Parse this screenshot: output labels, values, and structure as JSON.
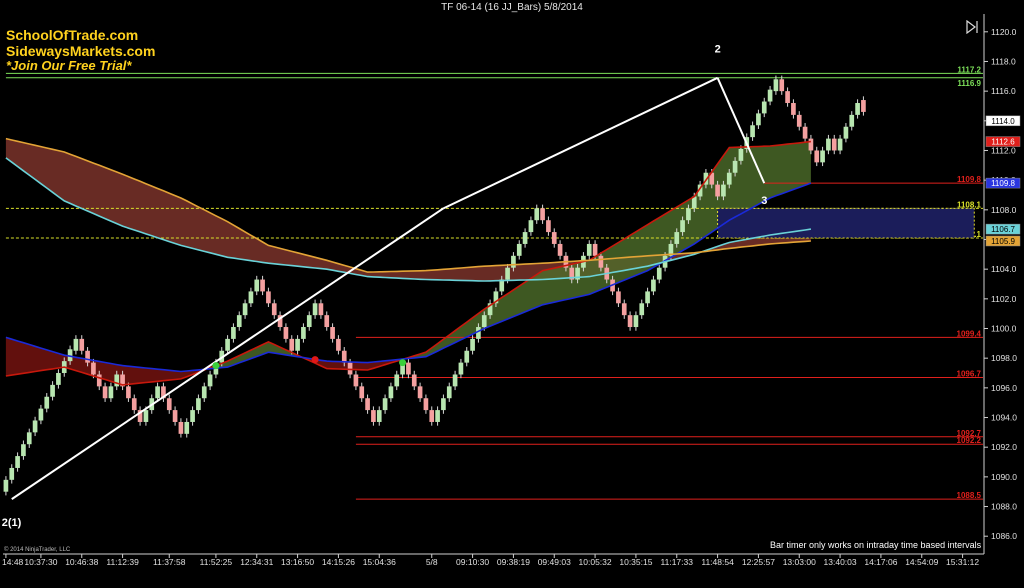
{
  "window": {
    "title": "TF 06-14 (16 JJ_Bars)  5/8/2014"
  },
  "promo": {
    "line1": "SchoolOfTrade.com",
    "line2": "SidewaysMarkets.com",
    "line3": "*Join Our Free Trial*"
  },
  "footer": {
    "copyright": "© 2014 NinjaTrader, LLC",
    "timer_note": "Bar timer only works on intraday time based intervals"
  },
  "colors": {
    "background": "#000000",
    "up_bar": "#b8e6b0",
    "down_bar": "#f4a0a0",
    "wick": "#d8d8d8",
    "red_level": "#e0201c",
    "green_level": "#7de05a",
    "yellow_level": "#d9e02a",
    "blue_ma": "#1a2ad8",
    "red_ma": "#c8180c",
    "cyan_ma": "#6ad2d8",
    "orange_ma": "#e3a436",
    "cloud_red": "#8b3a30",
    "cloud_green": "#4d6e2a",
    "zone_fill": "#1b1d5a",
    "zone_border": "#e6e030",
    "trend_line": "#ffffff"
  },
  "chart_data": {
    "type": "line",
    "title": "TF 06-14 (16 JJ_Bars)  5/8/2014",
    "ylim": [
      1084.8,
      1121.2
    ],
    "y_ticks": [
      "1086.0",
      "1088.0",
      "1090.0",
      "1092.0",
      "1094.0",
      "1096.0",
      "1098.0",
      "1100.0",
      "1102.0",
      "1104.0",
      "1106.0",
      "1108.0",
      "1110.0",
      "1112.0",
      "1114.0",
      "1116.0",
      "1118.0",
      "1120.0"
    ],
    "x_tick_labels": [
      "14:48",
      "10:37:30",
      "10:46:38",
      "11:12:39",
      "11:37:58",
      "11:52:25",
      "12:34:31",
      "13:16:50",
      "14:15:26",
      "15:04:36",
      "5/8",
      "09:10:30",
      "09:38:19",
      "09:49:03",
      "10:05:32",
      "10:35:15",
      "11:17:33",
      "11:48:54",
      "12:25:57",
      "13:03:00",
      "13:40:03",
      "14:17:06",
      "14:54:09",
      "15:31:12"
    ],
    "x_tick_index": [
      0,
      6,
      13,
      20,
      28,
      36,
      43,
      50,
      57,
      64,
      73,
      80,
      87,
      94,
      101,
      108,
      115,
      122,
      129,
      136,
      143,
      150,
      157,
      164
    ],
    "bar_count": 121,
    "slot_count": 168,
    "closes": [
      1089.8,
      1090.6,
      1091.4,
      1092.2,
      1093.0,
      1093.8,
      1094.6,
      1095.4,
      1096.2,
      1097.0,
      1097.8,
      1098.6,
      1099.3,
      1098.5,
      1097.7,
      1096.9,
      1096.1,
      1095.3,
      1096.1,
      1096.9,
      1096.1,
      1095.3,
      1094.5,
      1093.7,
      1094.5,
      1095.3,
      1096.1,
      1095.3,
      1094.5,
      1093.7,
      1092.9,
      1093.7,
      1094.5,
      1095.3,
      1096.1,
      1096.9,
      1097.7,
      1098.5,
      1099.3,
      1100.1,
      1100.9,
      1101.7,
      1102.5,
      1103.3,
      1102.5,
      1101.7,
      1100.9,
      1100.1,
      1099.3,
      1098.5,
      1099.3,
      1100.1,
      1100.9,
      1101.7,
      1100.9,
      1100.1,
      1099.3,
      1098.5,
      1097.7,
      1096.9,
      1096.1,
      1095.3,
      1094.5,
      1093.7,
      1094.5,
      1095.3,
      1096.1,
      1096.9,
      1097.7,
      1096.9,
      1096.1,
      1095.3,
      1094.5,
      1093.7,
      1094.5,
      1095.3,
      1096.1,
      1096.9,
      1097.7,
      1098.5,
      1099.3,
      1100.1,
      1100.9,
      1101.7,
      1102.5,
      1103.3,
      1104.1,
      1104.9,
      1105.7,
      1106.5,
      1107.3,
      1108.1,
      1107.3,
      1106.5,
      1105.7,
      1104.9,
      1104.1,
      1103.3,
      1104.1,
      1104.9,
      1105.7,
      1104.9,
      1104.1,
      1103.3,
      1102.5,
      1101.7,
      1100.9,
      1100.1,
      1100.9,
      1101.7,
      1102.5,
      1103.3,
      1104.1,
      1104.9,
      1105.7,
      1106.5,
      1107.3,
      1108.1,
      1108.9,
      1109.7,
      1110.5
    ],
    "closes_tail": [
      1109.7,
      1108.9,
      1109.7,
      1110.5,
      1111.3,
      1112.1,
      1112.9,
      1113.7,
      1114.5,
      1115.3,
      1116.1,
      1116.8,
      1116.0,
      1115.2,
      1114.4,
      1113.6,
      1112.8,
      1112.0,
      1111.2,
      1112.0,
      1112.8,
      1112.0,
      1112.8,
      1113.6,
      1114.4,
      1115.2,
      1114.6
    ],
    "series": [
      {
        "name": "",
        "role": "fast-red-ma",
        "points": [
          [
            0,
            1096.8
          ],
          [
            10,
            1097.4
          ],
          [
            20,
            1096.2
          ],
          [
            30,
            1096.6
          ],
          [
            38,
            1097.8
          ],
          [
            45,
            1099.1
          ],
          [
            55,
            1097.3
          ],
          [
            62,
            1097.2
          ],
          [
            72,
            1098.4
          ],
          [
            82,
            1101.3
          ],
          [
            92,
            1103.9
          ],
          [
            100,
            1104.6
          ],
          [
            110,
            1107.0
          ],
          [
            118,
            1108.9
          ],
          [
            124,
            1112.2
          ],
          [
            131,
            1112.3
          ],
          [
            138,
            1112.6
          ]
        ]
      },
      {
        "name": "",
        "role": "blue-ma",
        "points": [
          [
            0,
            1099.4
          ],
          [
            10,
            1098.2
          ],
          [
            20,
            1097.5
          ],
          [
            30,
            1097.1
          ],
          [
            38,
            1097.4
          ],
          [
            45,
            1098.4
          ],
          [
            55,
            1097.8
          ],
          [
            62,
            1097.7
          ],
          [
            72,
            1098.1
          ],
          [
            82,
            1100.0
          ],
          [
            92,
            1101.6
          ],
          [
            100,
            1102.3
          ],
          [
            110,
            1103.9
          ],
          [
            118,
            1105.7
          ],
          [
            124,
            1107.3
          ],
          [
            131,
            1108.8
          ],
          [
            138,
            1109.8
          ]
        ]
      },
      {
        "name": "",
        "role": "cyan-ma",
        "points": [
          [
            0,
            1111.5
          ],
          [
            10,
            1108.6
          ],
          [
            20,
            1106.9
          ],
          [
            30,
            1105.6
          ],
          [
            38,
            1104.8
          ],
          [
            45,
            1104.4
          ],
          [
            55,
            1104.0
          ],
          [
            62,
            1103.5
          ],
          [
            72,
            1103.3
          ],
          [
            82,
            1103.2
          ],
          [
            92,
            1103.3
          ],
          [
            100,
            1103.5
          ],
          [
            110,
            1104.2
          ],
          [
            118,
            1105.0
          ],
          [
            124,
            1105.8
          ],
          [
            131,
            1106.3
          ],
          [
            138,
            1106.7
          ]
        ]
      },
      {
        "name": "",
        "role": "orange-ma",
        "points": [
          [
            0,
            1112.8
          ],
          [
            10,
            1111.9
          ],
          [
            20,
            1110.4
          ],
          [
            30,
            1108.8
          ],
          [
            38,
            1107.2
          ],
          [
            45,
            1105.6
          ],
          [
            55,
            1104.6
          ],
          [
            62,
            1103.8
          ],
          [
            72,
            1103.9
          ],
          [
            82,
            1104.2
          ],
          [
            92,
            1104.4
          ],
          [
            100,
            1104.6
          ],
          [
            110,
            1104.9
          ],
          [
            118,
            1105.1
          ],
          [
            124,
            1105.4
          ],
          [
            131,
            1105.7
          ],
          [
            138,
            1105.9
          ]
        ]
      }
    ],
    "horizontal_levels": [
      {
        "value": "1117.2",
        "y": 1117.2,
        "color": "green",
        "label_color": "#7de05a"
      },
      {
        "value": "1116.9",
        "y": 1116.9,
        "color": "green",
        "label_color": "#7de05a"
      },
      {
        "value": "1109.8",
        "y": 1109.8,
        "color": "red",
        "label_color": "#e0201c"
      },
      {
        "value": "1108.1",
        "y": 1108.1,
        "color": "yellow",
        "label_color": "#d9e02a"
      },
      {
        "value": "1106.1",
        "y": 1106.1,
        "color": "yellow",
        "label_color": "#d9e02a"
      },
      {
        "value": "1099.4",
        "y": 1099.4,
        "color": "red",
        "label_color": "#e0201c"
      },
      {
        "value": "1096.7",
        "y": 1096.7,
        "color": "red",
        "label_color": "#e0201c"
      },
      {
        "value": "1092.7",
        "y": 1092.7,
        "color": "red",
        "label_color": "#e0201c"
      },
      {
        "value": "1092.2",
        "y": 1092.2,
        "color": "red",
        "label_color": "#e0201c"
      },
      {
        "value": "1088.5",
        "y": 1088.5,
        "color": "red",
        "label_color": "#e0201c"
      }
    ],
    "axis_badges": [
      {
        "value": "1114.0",
        "y": 1114.0,
        "bg": "#ffffff",
        "fg": "#000000"
      },
      {
        "value": "1112.6",
        "y": 1112.6,
        "bg": "#e0201c",
        "fg": "#ffffff"
      },
      {
        "value": "1109.8",
        "y": 1109.8,
        "bg": "#2a36e0",
        "fg": "#ffffff"
      },
      {
        "value": "1106.7",
        "y": 1106.7,
        "bg": "#6ad2d8",
        "fg": "#000000"
      },
      {
        "value": "1105.9",
        "y": 1105.9,
        "bg": "#e3a436",
        "fg": "#000000"
      }
    ],
    "trend_line_points": [
      [
        1,
        1088.5
      ],
      [
        75,
        1108.1
      ],
      [
        122,
        1116.9
      ],
      [
        130,
        1109.8
      ]
    ],
    "swing_labels": [
      {
        "text": "2(1)",
        "x": 1,
        "y": 1086.7
      },
      {
        "text": "2",
        "x": 122,
        "y": 1118.6
      },
      {
        "text": "3",
        "x": 130,
        "y": 1108.4
      }
    ],
    "zone": {
      "x_start": 122,
      "x_end": 166,
      "y_top": 1108.1,
      "y_bottom": 1106.1
    },
    "signal_dots": [
      {
        "x": 36,
        "y": 1097.5,
        "color": "green"
      },
      {
        "x": 53,
        "y": 1097.9,
        "color": "red"
      },
      {
        "x": 68,
        "y": 1097.7,
        "color": "green"
      }
    ],
    "grid": false,
    "legend": "none"
  }
}
